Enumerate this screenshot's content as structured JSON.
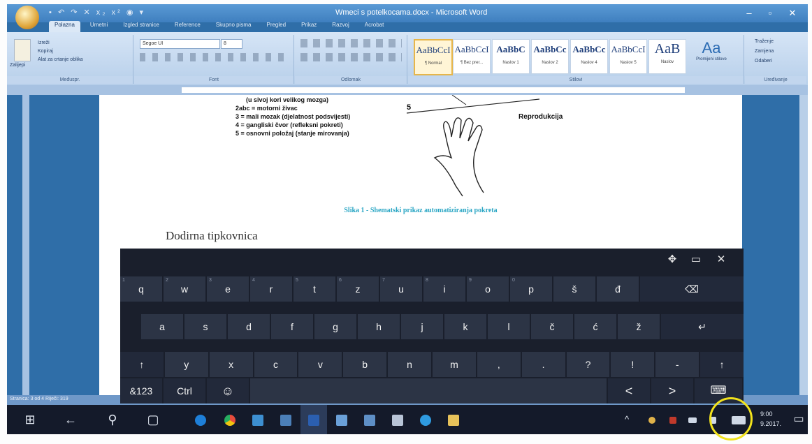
{
  "window": {
    "title": "Wmeci s potelkocama.docx - Microsoft Word",
    "quick_access": "▪ ↶ ↷ ✕ x₂ x² ◉ ▾",
    "minimize": "–",
    "maximize": "▫",
    "close": "✕"
  },
  "ribbon": {
    "tabs": [
      "Polazna",
      "Umetni",
      "Izgled stranice",
      "Reference",
      "Skupno pisma",
      "Pregled",
      "Prikaz",
      "Razvoj",
      "Acrobat"
    ],
    "clipboard": {
      "paste": "Zalijepi",
      "cut": "Izreži",
      "copy": "Kopiraj",
      "format_painter": "Alat za crtanje oblika",
      "label": "Međuspr."
    },
    "font": {
      "name": "Segoe UI",
      "size": "8",
      "label": "Font"
    },
    "paragraph": {
      "label": "Odlomak"
    },
    "styles": {
      "label": "Stilovi",
      "items": [
        {
          "sample": "AaBbCcI",
          "name": "¶ Normal"
        },
        {
          "sample": "AaBbCcI",
          "name": "¶ Bez prer..."
        },
        {
          "sample": "AaBbC",
          "name": "Naslov 1"
        },
        {
          "sample": "AaBbCc",
          "name": "Naslov 2"
        },
        {
          "sample": "AaBbCc",
          "name": "Naslov 4"
        },
        {
          "sample": "AaBbCcI",
          "name": "Naslov 5"
        },
        {
          "sample": "AaB",
          "name": "Naslov"
        }
      ],
      "change_styles": "Promijeni stilove"
    },
    "editing": {
      "find": "Traženje",
      "replace": "Zamjena",
      "select": "Odaberi",
      "label": "Uređivanje"
    }
  },
  "document": {
    "legend_lines": [
      "(u sivoj kori velikog mozga)",
      "2abc = motorni živac",
      "3 = mali mozak (djelatnost podsvijesti)",
      "4 = gangliski čvor (refleksni pokreti)",
      "5 = osnovni položaj (stanje mirovanja)"
    ],
    "figure_number": "5",
    "figure_label": "Reprodukcija",
    "caption": "Slika 1 - Shematski prikaz automatiziranja pokreta",
    "heading": "Dodirna tipkovnica"
  },
  "statusbar": {
    "text": "Stranica: 3 od 4    Riječi: 319"
  },
  "keyboard": {
    "top_buttons": {
      "move": "✥",
      "dock": "▭",
      "close": "✕"
    },
    "row1": [
      {
        "label": "q",
        "hint": "1"
      },
      {
        "label": "w",
        "hint": "2"
      },
      {
        "label": "e",
        "hint": "3"
      },
      {
        "label": "r",
        "hint": "4"
      },
      {
        "label": "t",
        "hint": "5"
      },
      {
        "label": "z",
        "hint": "6"
      },
      {
        "label": "u",
        "hint": "7"
      },
      {
        "label": "i",
        "hint": "8"
      },
      {
        "label": "o",
        "hint": "9"
      },
      {
        "label": "p",
        "hint": "0"
      },
      {
        "label": "š",
        "hint": ""
      },
      {
        "label": "đ",
        "hint": ""
      }
    ],
    "backspace": "⌫",
    "row2": [
      "a",
      "s",
      "d",
      "f",
      "g",
      "h",
      "j",
      "k",
      "l",
      "č",
      "ć",
      "ž"
    ],
    "enter": "↵",
    "row3": [
      "↑",
      "y",
      "x",
      "c",
      "v",
      "b",
      "n",
      "m",
      ",",
      ".",
      "?",
      "!",
      "-",
      "↑"
    ],
    "row4": {
      "symbols": "&123",
      "ctrl": "Ctrl",
      "emoji": "☺",
      "left": "<",
      "right": ">",
      "keyboard_switch": "⌨"
    }
  },
  "taskbar": {
    "start": "⊞",
    "back": "←",
    "search": "⚲",
    "task_view": "▢",
    "tray_up": "^",
    "clock_time": "9:00",
    "clock_date": "9.2017."
  }
}
